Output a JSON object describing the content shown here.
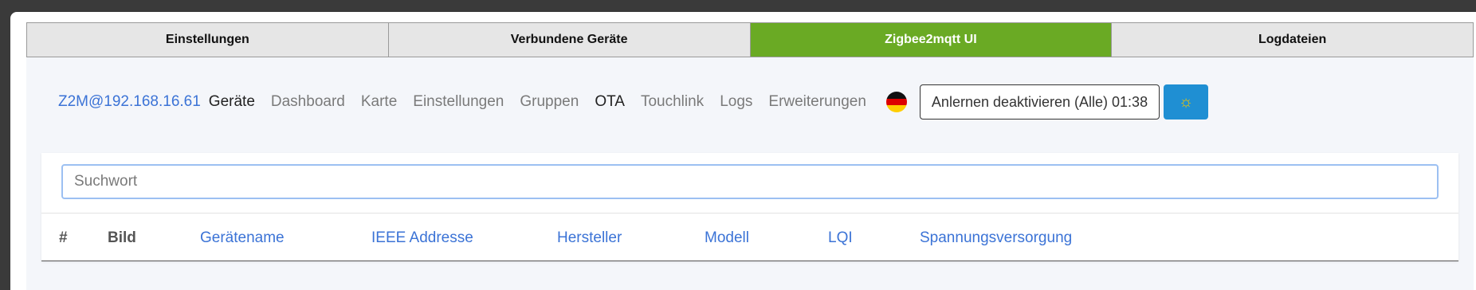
{
  "tabs": [
    {
      "label": "Einstellungen",
      "active": false
    },
    {
      "label": "Verbundene Geräte",
      "active": false
    },
    {
      "label": "Zigbee2mqtt UI",
      "active": true
    },
    {
      "label": "Logdateien",
      "active": false
    }
  ],
  "nav": {
    "brand": "Z2M@192.168.16.61",
    "items": [
      "Geräte",
      "Dashboard",
      "Karte",
      "Einstellungen",
      "Gruppen",
      "OTA",
      "Touchlink",
      "Logs",
      "Erweiterungen"
    ],
    "active_item": "Geräte",
    "language_flag": "german-flag-icon",
    "permit_join_button": "Anlernen deaktivieren (Alle) 01:38",
    "theme_button_icon": "sun-icon"
  },
  "search": {
    "placeholder": "Suchwort",
    "value": ""
  },
  "table": {
    "columns": [
      "#",
      "Bild",
      "Gerätename",
      "IEEE Addresse",
      "Hersteller",
      "Modell",
      "LQI",
      "Spannungsversorgung"
    ]
  },
  "colors": {
    "active_tab": "#6aaa24",
    "link": "#3b73d6",
    "theme_button": "#1f8fd3"
  }
}
